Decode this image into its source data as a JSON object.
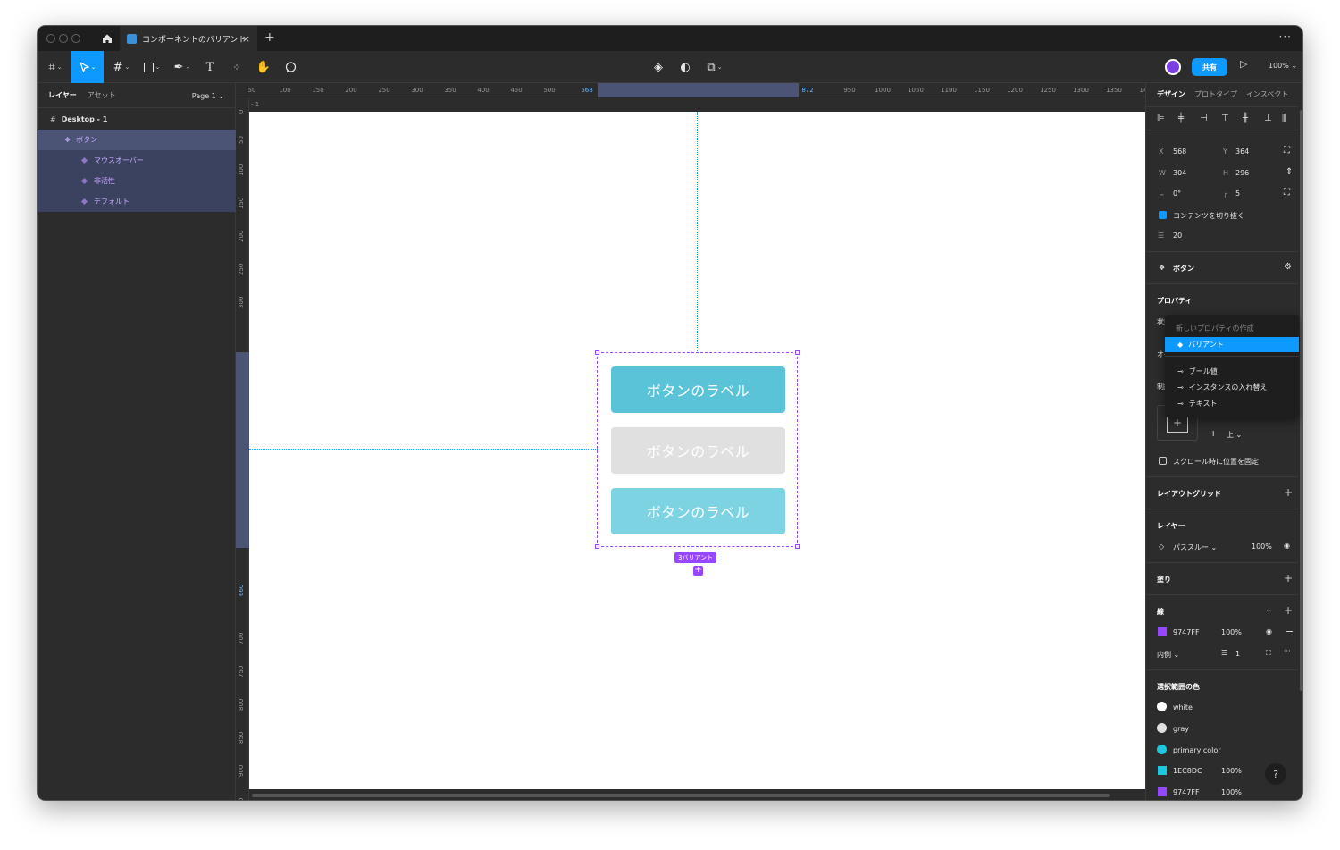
{
  "window": {
    "tab_title": "コンポーネントのバリアント"
  },
  "toolbar": {
    "share_label": "共有",
    "zoom": "100%"
  },
  "left_panel": {
    "tabs": [
      "レイヤー",
      "アセット"
    ],
    "page": "Page 1",
    "layers": [
      {
        "name": "Desktop - 1"
      },
      {
        "name": "ボタン"
      },
      {
        "name": "マウスオーバー"
      },
      {
        "name": "非活性"
      },
      {
        "name": "デフォルト"
      }
    ]
  },
  "rulers": {
    "top": [
      "50",
      "100",
      "150",
      "200",
      "250",
      "300",
      "350",
      "400",
      "450",
      "500",
      "568",
      "600",
      "650",
      "700",
      "750",
      "800",
      "872",
      "950",
      "1000",
      "1050",
      "1100",
      "1150",
      "1200",
      "1250",
      "1300",
      "1350",
      "14"
    ],
    "left": [
      "0",
      "50",
      "100",
      "150",
      "200",
      "250",
      "300",
      "364",
      "400",
      "450",
      "500",
      "550",
      "600",
      "660",
      "700",
      "750",
      "800",
      "850",
      "900",
      "950",
      "1000",
      "0"
    ]
  },
  "canvas": {
    "frame_label": "- 1",
    "buttons": [
      {
        "label": "ボタンのラベル",
        "color": "#5BC3D8"
      },
      {
        "label": "ボタンのラベル",
        "color": "#E0E0E0"
      },
      {
        "label": "ボタンのラベル",
        "color": "#7DD3E2"
      }
    ],
    "variant_tag": "3バリアント",
    "selection_color": "#9747FF"
  },
  "right_panel": {
    "tabs": [
      "デザイン",
      "プロトタイプ",
      "インスペクト"
    ],
    "x_label": "X",
    "x": "568",
    "y_label": "Y",
    "y": "364",
    "w_label": "W",
    "w": "304",
    "h_label": "H",
    "h": "296",
    "rotation": "0°",
    "radius": "5",
    "clip_content": "コンテンツを切り抜く",
    "spacing": "20",
    "component_name": "ボタン",
    "properties_title": "プロパティ",
    "state_label": "状態",
    "auto_label": "オ-",
    "constraint_label": "制約",
    "constraint_vertical": "上",
    "fix_on_scroll": "スクロール時に位置を固定",
    "layout_grid": "レイアウトグリッド",
    "layer_title": "レイヤー",
    "blend": "パススルー",
    "layer_opacity": "100%",
    "fill_title": "塗り",
    "stroke_title": "線",
    "stroke_color": "9747FF",
    "stroke_opacity": "100%",
    "stroke_position": "内側",
    "stroke_width": "1",
    "selection_colors_title": "選択範囲の色",
    "selection_colors": [
      {
        "name": "white",
        "color": "#FFFFFF"
      },
      {
        "name": "gray",
        "color": "#E0E0E0"
      },
      {
        "name": "primary color",
        "color": "#1EC8DC"
      }
    ],
    "hex_colors": [
      {
        "hex": "1EC8DC",
        "opacity": "100%",
        "color": "#1EC8DC"
      },
      {
        "hex": "9747FF",
        "opacity": "100%",
        "color": "#9747FF"
      }
    ]
  },
  "dropdown": {
    "header": "新しいプロパティの作成",
    "items": [
      "バリアント",
      "ブール値",
      "インスタンスの入れ替え",
      "テキスト"
    ]
  },
  "help_label": "?"
}
